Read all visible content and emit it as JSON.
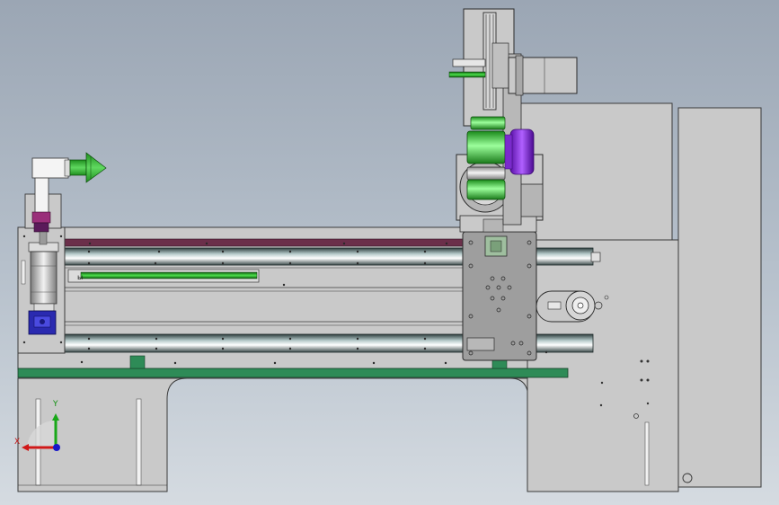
{
  "viewport": {
    "background_top": "#9ba6b4",
    "background_bottom": "#d5dbe1"
  },
  "palette": {
    "body": "#c8c8c8",
    "body_dark": "#a8a8a8",
    "edge": "#3a3a3a",
    "rail": "#c0d0d0",
    "green_base": "#2e8b57",
    "green_part": "#28b428",
    "purple": "#9a2cf0",
    "maroon": "#6b2f4a",
    "blue_part": "#2a2ab0"
  },
  "triad": {
    "x_label": "X",
    "y_label": "Y",
    "x_color": "#d01818",
    "y_color": "#18a818",
    "z_color": "#1818c8"
  }
}
